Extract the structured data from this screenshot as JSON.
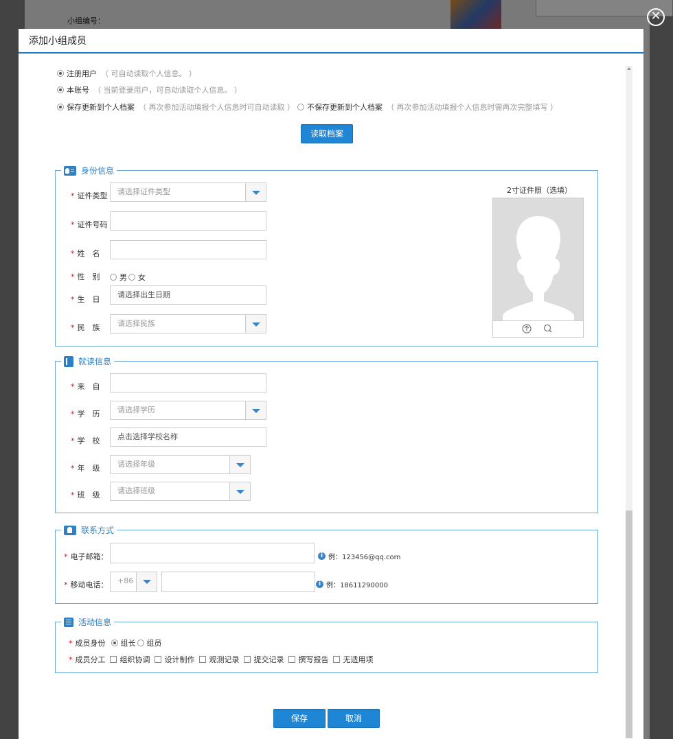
{
  "background": {
    "label": "小组编号："
  },
  "dialog": {
    "title": "添加小组成员",
    "close_glyph": "✕"
  },
  "source_options": {
    "registered": {
      "label": "注册用户",
      "hint": "（ 可自动读取个人信息。 ）"
    },
    "this_account": {
      "label": "本账号",
      "hint": "（ 当前登录用户，可自动读取个人信息。 ）"
    },
    "save_profile": {
      "label": "保存更新到个人档案",
      "hint": "（ 再次参加活动填报个人信息时可自动读取 ）"
    },
    "no_save_profile": {
      "label": "不保存更新到个人档案",
      "hint": "（ 再次参加活动填报个人信息时需再次完整填写 ）"
    }
  },
  "read_profile_button": "读取档案",
  "identity": {
    "legend": "身份信息",
    "id_type": {
      "label": "证件类型",
      "placeholder": "请选择证件类型"
    },
    "id_number": {
      "label": "证件号码",
      "value": ""
    },
    "name": {
      "label": "姓　名",
      "value": ""
    },
    "gender": {
      "label": "性　别",
      "options": [
        "男",
        "女"
      ]
    },
    "birth": {
      "label": "生　日",
      "placeholder": "请选择出生日期"
    },
    "ethnicity": {
      "label": "民　族",
      "placeholder": "请选择民族"
    },
    "photo_title": "2寸证件照（选填）"
  },
  "school": {
    "legend": "就读信息",
    "from": {
      "label": "来　自",
      "value": ""
    },
    "education": {
      "label": "学　历",
      "placeholder": "请选择学历"
    },
    "school": {
      "label": "学　校",
      "placeholder": "点击选择学校名称"
    },
    "grade": {
      "label": "年　级",
      "placeholder": "请选择年级"
    },
    "class": {
      "label": "班　级",
      "placeholder": "请选择班级"
    }
  },
  "contact": {
    "legend": "联系方式",
    "email": {
      "label": "电子邮箱：",
      "tip": "例：123456@qq.com"
    },
    "mobile": {
      "label": "移动电话：",
      "prefix": "+86",
      "tip": "例：18611290000"
    }
  },
  "activity": {
    "legend": "活动信息",
    "role": {
      "label": "成员身份",
      "options": [
        "组长",
        "组员"
      ],
      "selected": "组长"
    },
    "division": {
      "label": "成员分工",
      "options": [
        "组织协调",
        "设计制作",
        "观测记录",
        "提交记录",
        "撰写报告",
        "无适用项"
      ]
    }
  },
  "footer": {
    "save": "保存",
    "cancel": "取消"
  },
  "colors": {
    "accent": "#1e86d4",
    "border": "#6ea6d8",
    "required": "#dd1122"
  }
}
